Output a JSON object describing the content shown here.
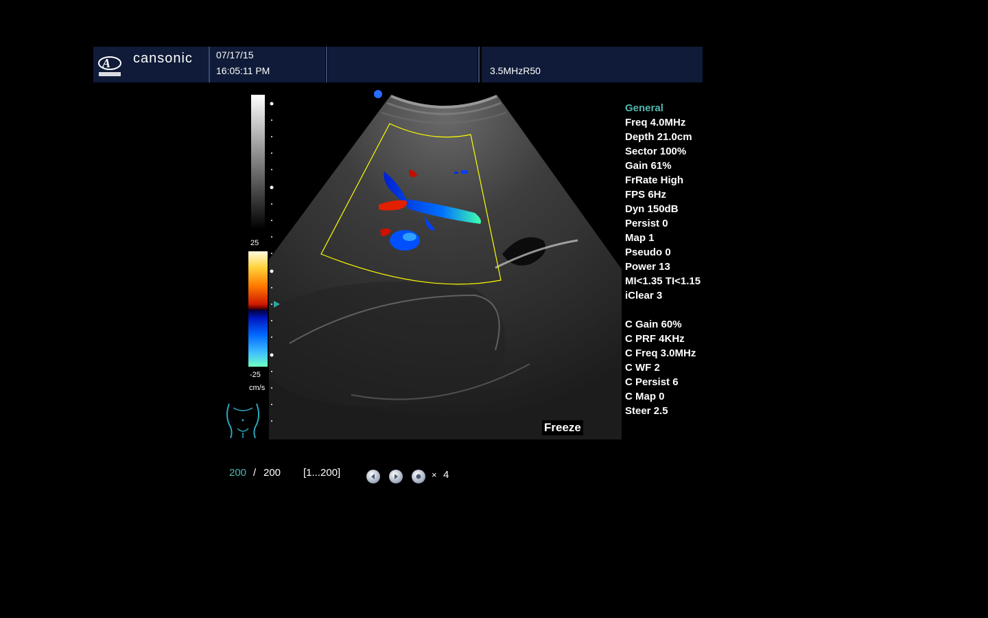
{
  "header": {
    "brand": "cansonic",
    "date": "07/17/15",
    "time": "16:05:11 PM",
    "probe": "3.5MHzR50"
  },
  "scales": {
    "top": "25",
    "bottom": "-25",
    "unit": "cm/s"
  },
  "parameters": [
    {
      "label": "General",
      "kind": "heading"
    },
    {
      "label": "Freq 4.0MHz"
    },
    {
      "label": "Depth 21.0cm"
    },
    {
      "label": "Sector 100%"
    },
    {
      "label": "Gain 61%"
    },
    {
      "label": "FrRate High"
    },
    {
      "label": "FPS 6Hz"
    },
    {
      "label": "Dyn 150dB"
    },
    {
      "label": "Persist 0"
    },
    {
      "label": "Map 1"
    },
    {
      "label": "Pseudo 0"
    },
    {
      "label": "Power 13"
    },
    {
      "label": "MI<1.35  TI<1.15"
    },
    {
      "label": "iClear 3"
    },
    {
      "label": "",
      "kind": "gap"
    },
    {
      "label": "C Gain 60%"
    },
    {
      "label": "C PRF 4KHz"
    },
    {
      "label": "C Freq 3.0MHz"
    },
    {
      "label": "C WF 2"
    },
    {
      "label": "C Persist 6"
    },
    {
      "label": "C Map 0"
    },
    {
      "label": "Steer 2.5"
    }
  ],
  "status": {
    "freeze_label": "Freeze"
  },
  "cine": {
    "current": "200",
    "separator": "/",
    "total": "200",
    "range": "[1...200]",
    "speed_prefix": "×",
    "speed": "4"
  },
  "colors": {
    "header_bg": "#0f1b38",
    "heading": "#4fb8b0",
    "roi_box": "#ffff00",
    "cine_current": "#4fb8b0"
  },
  "icons": {
    "logo": "cansonic-logo-icon",
    "body_marker": "abdomen-body-marker-icon",
    "prev": "previous-frame-icon",
    "play": "play-icon",
    "stop": "stop-icon"
  }
}
